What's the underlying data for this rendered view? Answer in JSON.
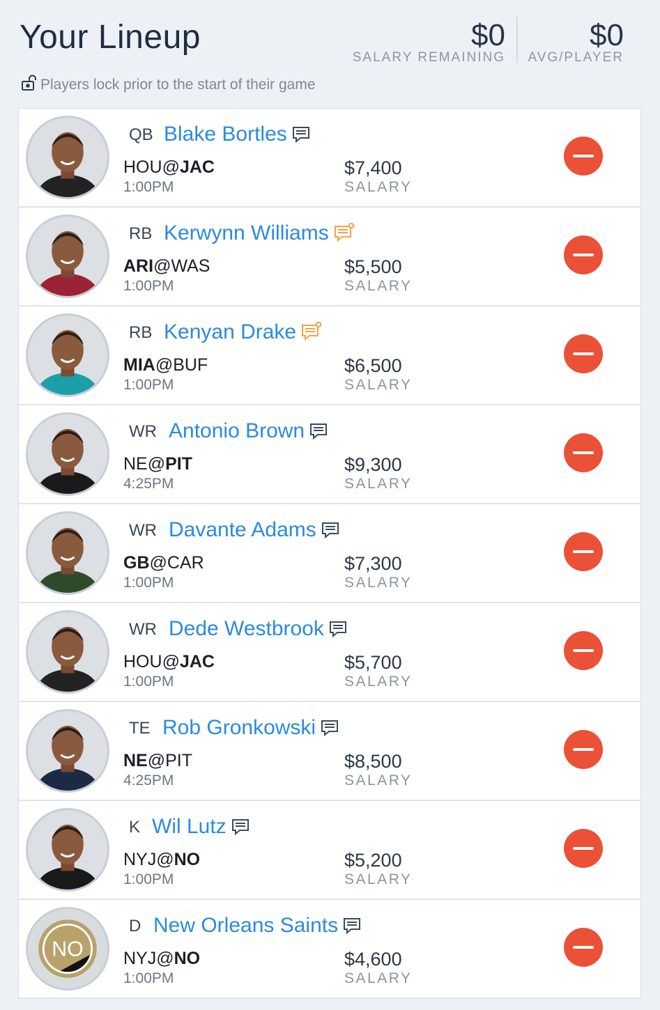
{
  "header": {
    "title": "Your Lineup",
    "salary_remaining": "$0",
    "salary_remaining_label": "SALARY REMAINING",
    "avg_player": "$0",
    "avg_player_label": "AVG/PLAYER",
    "lock_note": "Players lock prior to the start of their game"
  },
  "salary_label": "SALARY",
  "colors": {
    "accent": "#2a8ae0",
    "remove": "#ea5136",
    "news_alert": "#f4a340"
  },
  "players": [
    {
      "pos": "QB",
      "name": "Blake Bortles",
      "away": "HOU",
      "home": "JAC",
      "bold": "home",
      "time": "1:00PM",
      "salary": "$7,400",
      "news": "chat-icon",
      "jersey": "#222222"
    },
    {
      "pos": "RB",
      "name": "Kerwynn Williams",
      "away": "ARI",
      "home": "WAS",
      "bold": "away",
      "time": "1:00PM",
      "salary": "$5,500",
      "news": "chat-alert-icon",
      "jersey": "#9b2335"
    },
    {
      "pos": "RB",
      "name": "Kenyan Drake",
      "away": "MIA",
      "home": "BUF",
      "bold": "away",
      "time": "1:00PM",
      "salary": "$6,500",
      "news": "chat-alert-icon",
      "jersey": "#1ca0a8"
    },
    {
      "pos": "WR",
      "name": "Antonio Brown",
      "away": "NE",
      "home": "PIT",
      "bold": "home",
      "time": "4:25PM",
      "salary": "$9,300",
      "news": "chat-icon",
      "jersey": "#1a1a1a"
    },
    {
      "pos": "WR",
      "name": "Davante Adams",
      "away": "GB",
      "home": "CAR",
      "bold": "away",
      "time": "1:00PM",
      "salary": "$7,300",
      "news": "chat-icon",
      "jersey": "#2f4a2a"
    },
    {
      "pos": "WR",
      "name": "Dede Westbrook",
      "away": "HOU",
      "home": "JAC",
      "bold": "home",
      "time": "1:00PM",
      "salary": "$5,700",
      "news": "chat-icon",
      "jersey": "#222222"
    },
    {
      "pos": "TE",
      "name": "Rob Gronkowski",
      "away": "NE",
      "home": "PIT",
      "bold": "away",
      "time": "4:25PM",
      "salary": "$8,500",
      "news": "chat-icon",
      "jersey": "#1c2a44"
    },
    {
      "pos": "K",
      "name": "Wil Lutz",
      "away": "NYJ",
      "home": "NO",
      "bold": "home",
      "time": "1:00PM",
      "salary": "$5,200",
      "news": "chat-icon",
      "jersey": "#1a1a1a"
    },
    {
      "pos": "D",
      "name": "New Orleans Saints",
      "away": "NYJ",
      "home": "NO",
      "bold": "home",
      "time": "1:00PM",
      "salary": "$4,600",
      "news": "chat-icon",
      "logo_text": "NO"
    }
  ]
}
